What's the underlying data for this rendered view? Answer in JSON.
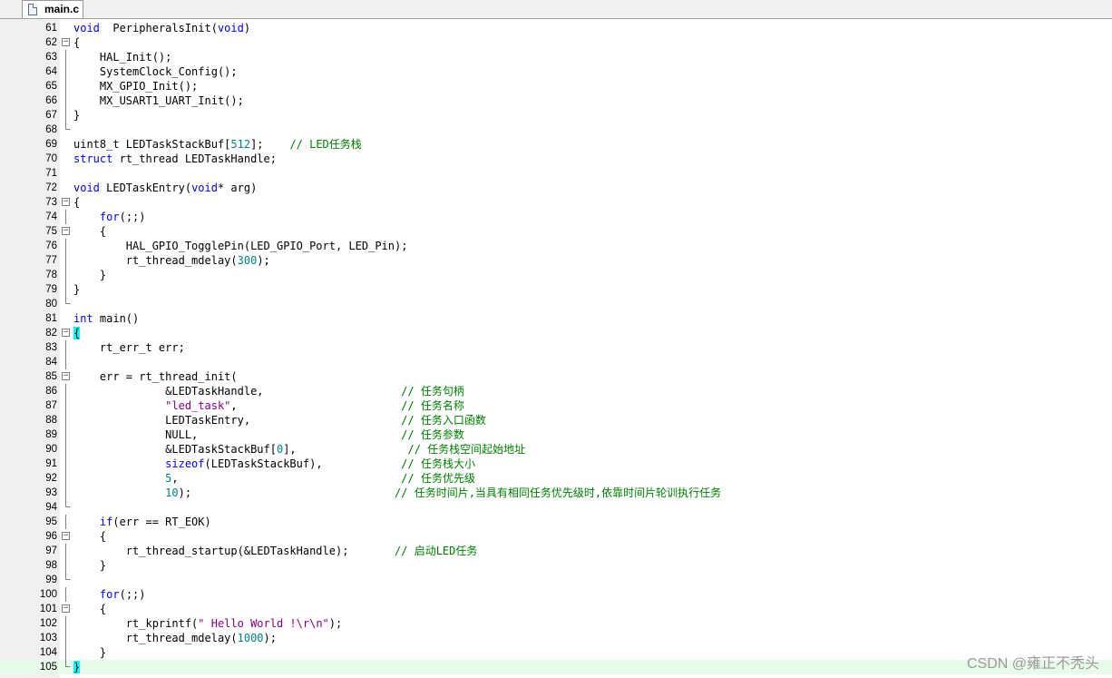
{
  "tab": {
    "filename": "main.c",
    "icon": "file-icon"
  },
  "colors": {
    "keyword": "#0000ff",
    "number": "#008080",
    "string": "#800080",
    "comment": "#008000",
    "current_line": "#e8fae8",
    "brace_highlight": "#00ffff"
  },
  "lines": [
    {
      "n": "61",
      "fold": "",
      "tokens": [
        [
          "kw",
          "void"
        ],
        [
          "",
          "  PeripheralsInit("
        ],
        [
          "kw",
          "void"
        ],
        [
          "",
          ")"
        ]
      ]
    },
    {
      "n": "62",
      "fold": "open",
      "tokens": [
        [
          "",
          "{"
        ]
      ]
    },
    {
      "n": "63",
      "fold": "bar",
      "tokens": [
        [
          "",
          "    HAL_Init();"
        ]
      ]
    },
    {
      "n": "64",
      "fold": "bar",
      "tokens": [
        [
          "",
          "    SystemClock_Config();"
        ]
      ]
    },
    {
      "n": "65",
      "fold": "bar",
      "tokens": [
        [
          "",
          "    MX_GPIO_Init();"
        ]
      ]
    },
    {
      "n": "66",
      "fold": "bar",
      "tokens": [
        [
          "",
          "    MX_USART1_UART_Init();"
        ]
      ]
    },
    {
      "n": "67",
      "fold": "bar",
      "tokens": [
        [
          "",
          "}"
        ]
      ]
    },
    {
      "n": "68",
      "fold": "end",
      "tokens": []
    },
    {
      "n": "69",
      "fold": "",
      "tokens": [
        [
          "",
          "uint8_t LEDTaskStackBuf["
        ],
        [
          "num",
          "512"
        ],
        [
          "",
          "];    "
        ],
        [
          "cmt",
          "// LED任务栈"
        ]
      ]
    },
    {
      "n": "70",
      "fold": "",
      "tokens": [
        [
          "kw",
          "struct"
        ],
        [
          "",
          " rt_thread LEDTaskHandle;"
        ]
      ]
    },
    {
      "n": "71",
      "fold": "",
      "tokens": []
    },
    {
      "n": "72",
      "fold": "",
      "tokens": [
        [
          "kw",
          "void"
        ],
        [
          "",
          " LEDTaskEntry("
        ],
        [
          "kw",
          "void"
        ],
        [
          "",
          "* arg)"
        ]
      ]
    },
    {
      "n": "73",
      "fold": "open",
      "tokens": [
        [
          "",
          "{"
        ]
      ]
    },
    {
      "n": "74",
      "fold": "bar",
      "tokens": [
        [
          "",
          "    "
        ],
        [
          "kw",
          "for"
        ],
        [
          "",
          "(;;)"
        ]
      ]
    },
    {
      "n": "75",
      "fold": "open",
      "tokens": [
        [
          "",
          "    {"
        ]
      ]
    },
    {
      "n": "76",
      "fold": "bar",
      "tokens": [
        [
          "",
          "        HAL_GPIO_TogglePin(LED_GPIO_Port, LED_Pin);"
        ]
      ]
    },
    {
      "n": "77",
      "fold": "bar",
      "tokens": [
        [
          "",
          "        rt_thread_mdelay("
        ],
        [
          "num",
          "300"
        ],
        [
          "",
          ");"
        ]
      ]
    },
    {
      "n": "78",
      "fold": "bar",
      "tokens": [
        [
          "",
          "    }"
        ]
      ]
    },
    {
      "n": "79",
      "fold": "bar",
      "tokens": [
        [
          "",
          "}"
        ]
      ]
    },
    {
      "n": "80",
      "fold": "end",
      "tokens": []
    },
    {
      "n": "81",
      "fold": "",
      "tokens": [
        [
          "kw",
          "int"
        ],
        [
          "",
          " main()"
        ]
      ]
    },
    {
      "n": "82",
      "fold": "open",
      "tokens": [
        [
          "hl",
          "{"
        ]
      ]
    },
    {
      "n": "83",
      "fold": "bar",
      "tokens": [
        [
          "",
          "    rt_err_t err;"
        ]
      ]
    },
    {
      "n": "84",
      "fold": "bar",
      "tokens": []
    },
    {
      "n": "85",
      "fold": "open",
      "tokens": [
        [
          "",
          "    err = rt_thread_init("
        ]
      ]
    },
    {
      "n": "86",
      "fold": "bar",
      "tokens": [
        [
          "",
          "              &LEDTaskHandle,                     "
        ],
        [
          "cmt",
          "// 任务句柄"
        ]
      ]
    },
    {
      "n": "87",
      "fold": "bar",
      "tokens": [
        [
          "",
          "              "
        ],
        [
          "str",
          "\"led_task\""
        ],
        [
          "",
          ",                         "
        ],
        [
          "cmt",
          "// 任务名称"
        ]
      ]
    },
    {
      "n": "88",
      "fold": "bar",
      "tokens": [
        [
          "",
          "              LEDTaskEntry,                       "
        ],
        [
          "cmt",
          "// 任务入口函数"
        ]
      ]
    },
    {
      "n": "89",
      "fold": "bar",
      "tokens": [
        [
          "",
          "              NULL,                               "
        ],
        [
          "cmt",
          "// 任务参数"
        ]
      ]
    },
    {
      "n": "90",
      "fold": "bar",
      "tokens": [
        [
          "",
          "              &LEDTaskStackBuf["
        ],
        [
          "num",
          "0"
        ],
        [
          "",
          "],                 "
        ],
        [
          "cmt",
          "// 任务栈空间起始地址"
        ]
      ]
    },
    {
      "n": "91",
      "fold": "bar",
      "tokens": [
        [
          "",
          "              "
        ],
        [
          "kw",
          "sizeof"
        ],
        [
          "",
          "(LEDTaskStackBuf),            "
        ],
        [
          "cmt",
          "// 任务栈大小"
        ]
      ]
    },
    {
      "n": "92",
      "fold": "bar",
      "tokens": [
        [
          "",
          "              "
        ],
        [
          "num",
          "5"
        ],
        [
          "",
          ",                                  "
        ],
        [
          "cmt",
          "// 任务优先级"
        ]
      ]
    },
    {
      "n": "93",
      "fold": "bar",
      "tokens": [
        [
          "",
          "              "
        ],
        [
          "num",
          "10"
        ],
        [
          "",
          ");                               "
        ],
        [
          "cmt",
          "// 任务时间片,当具有相同任务优先级时,依靠时间片轮训执行任务"
        ]
      ]
    },
    {
      "n": "94",
      "fold": "end",
      "tokens": []
    },
    {
      "n": "95",
      "fold": "bar",
      "tokens": [
        [
          "",
          "    "
        ],
        [
          "kw",
          "if"
        ],
        [
          "",
          "(err == RT_EOK)"
        ]
      ]
    },
    {
      "n": "96",
      "fold": "open",
      "tokens": [
        [
          "",
          "    {"
        ]
      ]
    },
    {
      "n": "97",
      "fold": "bar",
      "tokens": [
        [
          "",
          "        rt_thread_startup(&LEDTaskHandle);       "
        ],
        [
          "cmt",
          "// 启动LED任务"
        ]
      ]
    },
    {
      "n": "98",
      "fold": "bar",
      "tokens": [
        [
          "",
          "    }"
        ]
      ]
    },
    {
      "n": "99",
      "fold": "end",
      "tokens": []
    },
    {
      "n": "100",
      "fold": "bar",
      "tokens": [
        [
          "",
          "    "
        ],
        [
          "kw",
          "for"
        ],
        [
          "",
          "(;;)"
        ]
      ]
    },
    {
      "n": "101",
      "fold": "open",
      "tokens": [
        [
          "",
          "    {"
        ]
      ]
    },
    {
      "n": "102",
      "fold": "bar",
      "tokens": [
        [
          "",
          "        rt_kprintf("
        ],
        [
          "str",
          "\" Hello World !\\r\\n\""
        ],
        [
          "",
          ");"
        ]
      ]
    },
    {
      "n": "103",
      "fold": "bar",
      "tokens": [
        [
          "",
          "        rt_thread_mdelay("
        ],
        [
          "num",
          "1000"
        ],
        [
          "",
          ");"
        ]
      ]
    },
    {
      "n": "104",
      "fold": "bar",
      "tokens": [
        [
          "",
          "    }"
        ]
      ]
    },
    {
      "n": "105",
      "fold": "end",
      "tokens": [
        [
          "hl",
          "}"
        ]
      ]
    }
  ],
  "current_line": "105",
  "watermark": "CSDN @雍正不秃头"
}
